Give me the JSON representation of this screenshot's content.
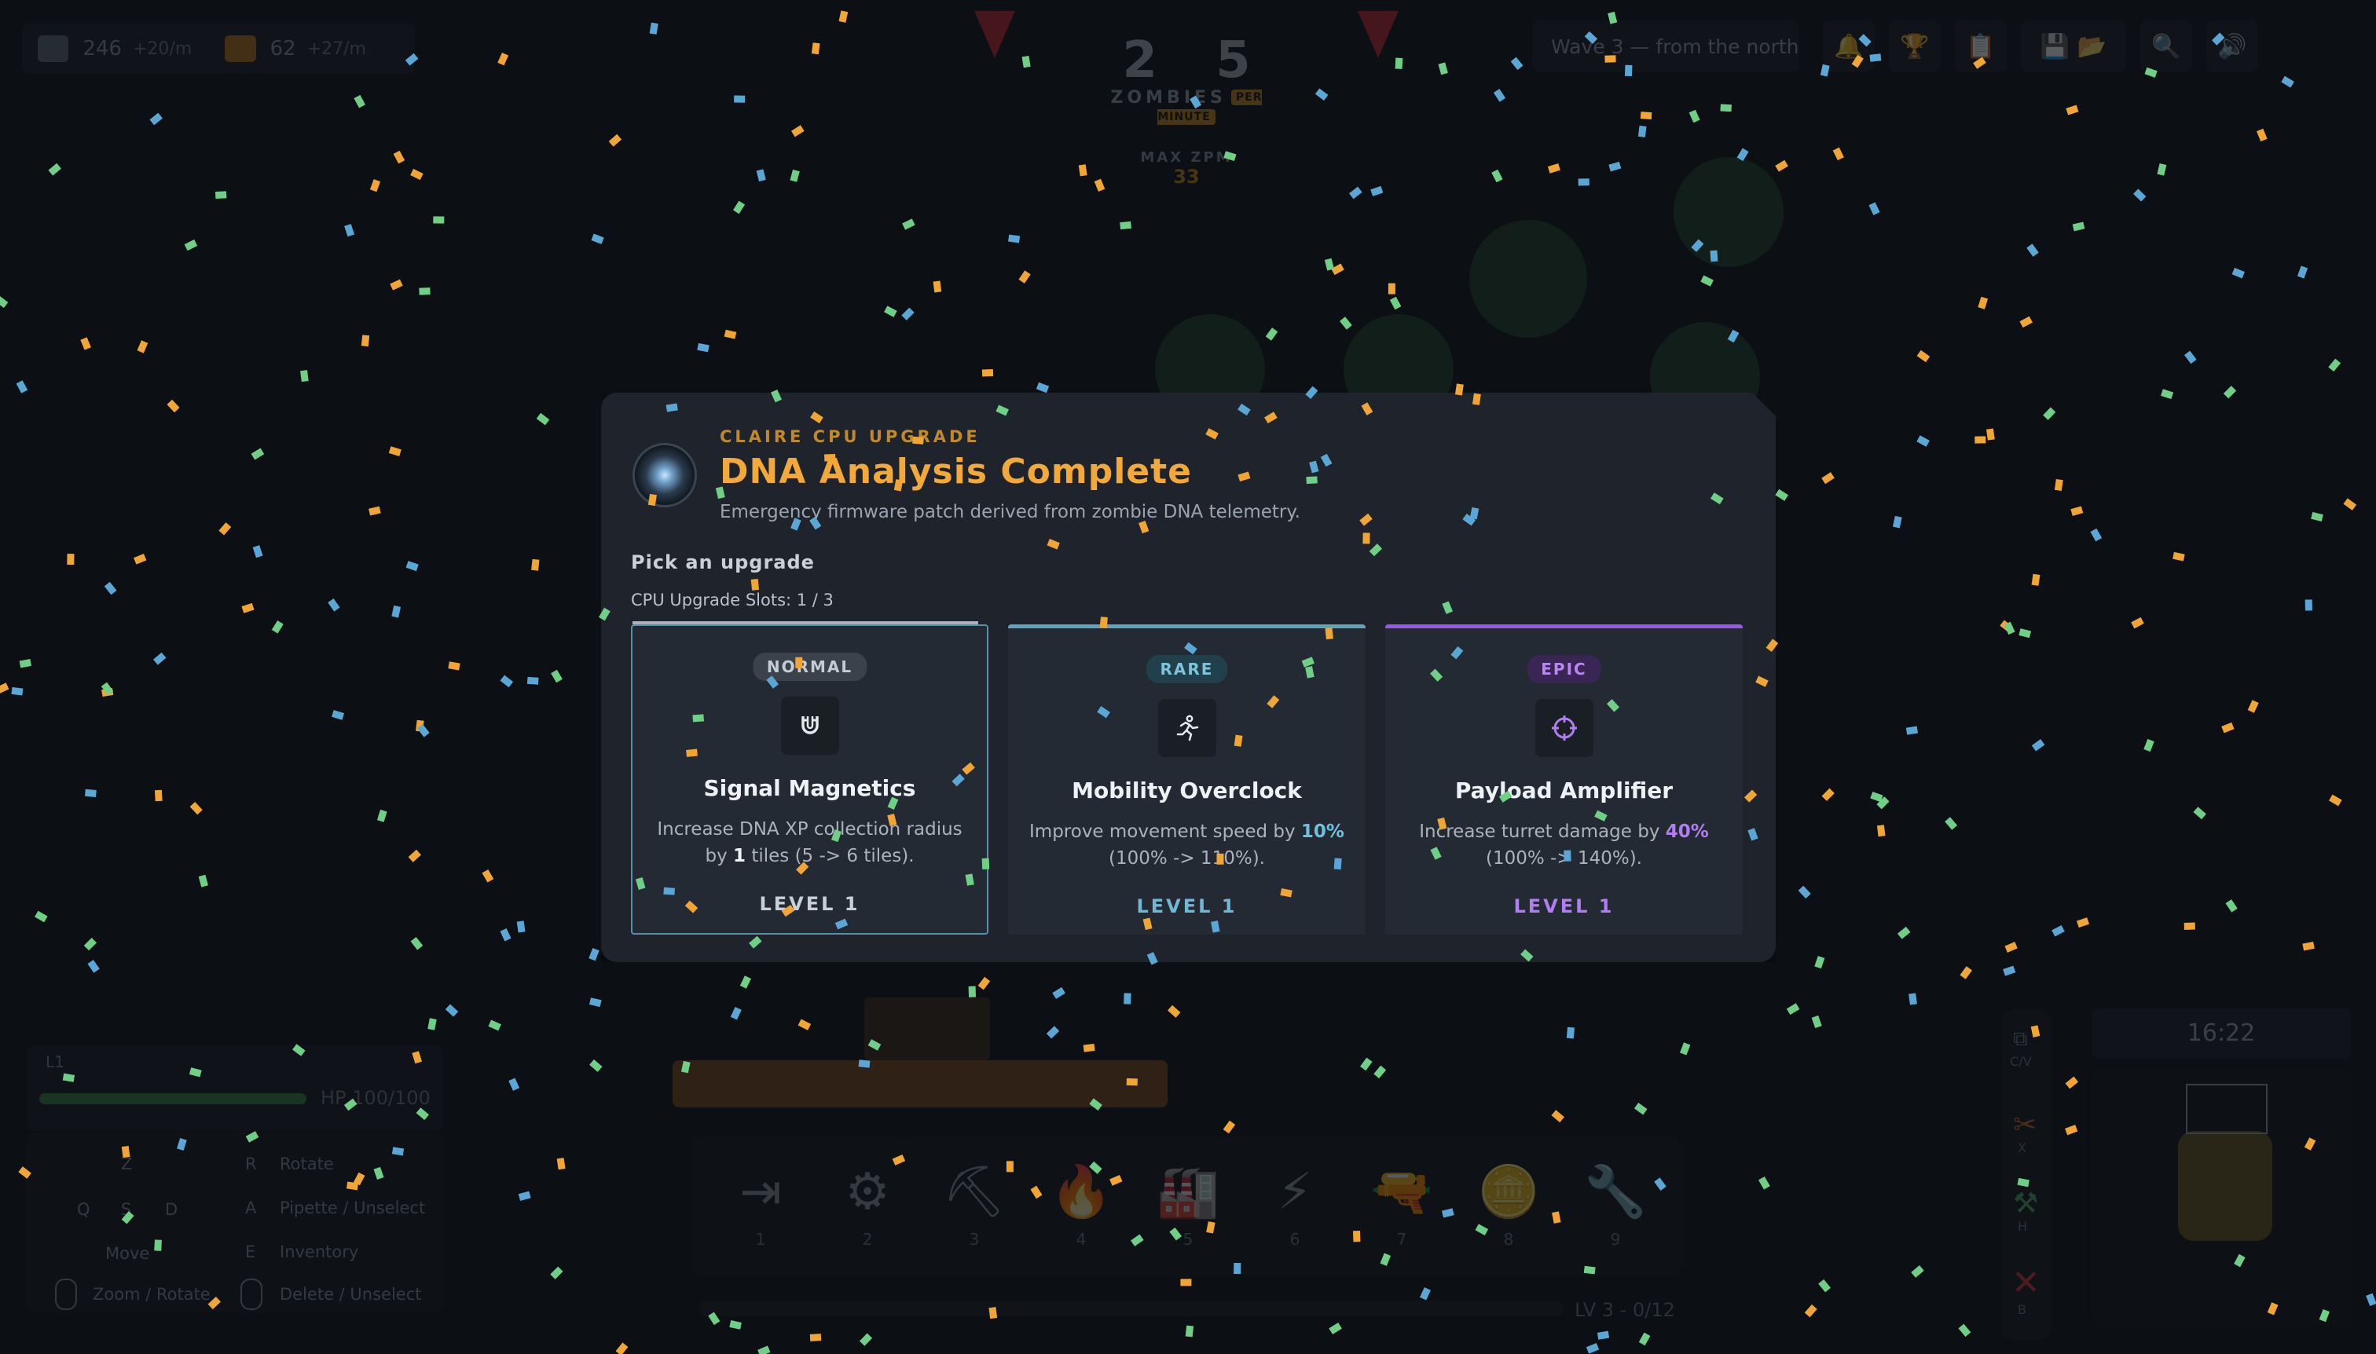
{
  "hud": {
    "resources": [
      {
        "amount": "246",
        "rate": "+20/m",
        "icon": "flesh-resource-icon"
      },
      {
        "amount": "62",
        "rate": "+27/m",
        "icon": "ore-resource-icon"
      }
    ],
    "zpm": {
      "value": "2 5",
      "label": "ZOMBIES",
      "tag": "PER MINUTE",
      "max_label": "MAX ZPM",
      "max_value": "33"
    },
    "wave": "Wave 3 — from the north",
    "level_badge": "L1",
    "hp_text": "HP 100/100",
    "hp_fraction": 1.0,
    "keys": {
      "z": "Z",
      "q": "Q",
      "s": "S",
      "d": "D",
      "move": "Move",
      "r": "R",
      "rotate": "Rotate",
      "a": "A",
      "pipette": "Pipette / Unselect",
      "e": "E",
      "inventory": "Inventory",
      "zoom": "Zoom / Rotate",
      "delete": "Delete / Unselect"
    },
    "toolbar": [
      "1",
      "2",
      "3",
      "4",
      "5",
      "6",
      "7",
      "8",
      "9"
    ],
    "xp_text": "LV 3 - 0/12",
    "timer": "16:22",
    "right_col": [
      "C/V",
      "X",
      "H",
      "B"
    ]
  },
  "modal": {
    "eyebrow": "CLAIRE CPU UPGRADE",
    "title": "DNA Analysis Complete",
    "subtitle": "Emergency firmware patch derived from zombie DNA telemetry.",
    "pick_label": "Pick an upgrade",
    "slots_label": "CPU Upgrade Slots: 1 / 3",
    "cards": [
      {
        "rarity": "NORMAL",
        "icon": "magnet-icon",
        "name": "Signal Magnetics",
        "desc_pre": "Increase DNA XP collection radius by ",
        "desc_hl": "1",
        "desc_post": " tiles (5 -> 6 tiles).",
        "level": "LEVEL 1"
      },
      {
        "rarity": "RARE",
        "icon": "running-person-icon",
        "name": "Mobility Overclock",
        "desc_pre": "Improve movement speed by ",
        "desc_hl": "10%",
        "desc_post": " (100% -> 110%).",
        "level": "LEVEL 1"
      },
      {
        "rarity": "EPIC",
        "icon": "crosshair-icon",
        "name": "Payload Amplifier",
        "desc_pre": "Increase turret damage by ",
        "desc_hl": "40%",
        "desc_post": " (100% -> 140%).",
        "level": "LEVEL 1"
      }
    ]
  },
  "colors": {
    "confetti": [
      "#f0a534",
      "#6fcf86",
      "#5aa7d6"
    ],
    "accent_gold": "#f2a93a",
    "rare": "#5ea4bf",
    "epic": "#9b58e6"
  }
}
